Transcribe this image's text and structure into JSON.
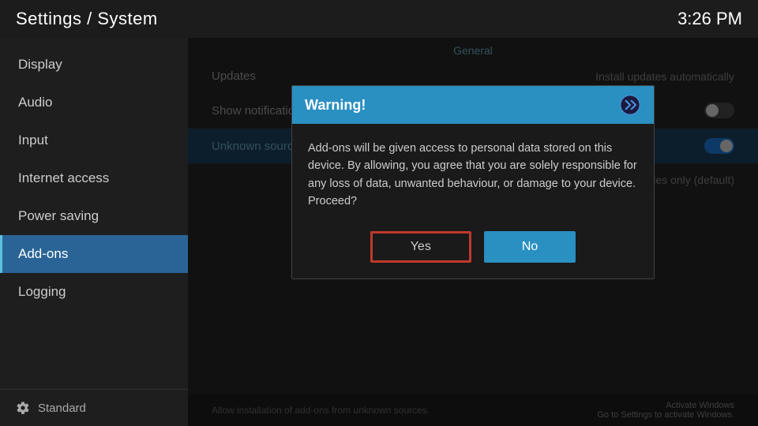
{
  "header": {
    "title": "Settings / System",
    "time": "3:26 PM"
  },
  "sidebar": {
    "items": [
      {
        "id": "display",
        "label": "Display",
        "active": false
      },
      {
        "id": "audio",
        "label": "Audio",
        "active": false
      },
      {
        "id": "input",
        "label": "Input",
        "active": false
      },
      {
        "id": "internet-access",
        "label": "Internet access",
        "active": false
      },
      {
        "id": "power-saving",
        "label": "Power saving",
        "active": false
      },
      {
        "id": "add-ons",
        "label": "Add-ons",
        "active": true
      },
      {
        "id": "logging",
        "label": "Logging",
        "active": false
      }
    ],
    "footer_label": "Standard"
  },
  "content": {
    "section_label": "General",
    "rows": [
      {
        "id": "updates",
        "label": "Updates",
        "value": "Install updates automatically",
        "toggle": null
      },
      {
        "id": "show-notifications",
        "label": "Show notifications",
        "value": "",
        "toggle": "off"
      },
      {
        "id": "unknown-sources",
        "label": "Unknown sources",
        "value": "",
        "toggle": "on",
        "highlighted": true
      },
      {
        "id": "official-repos",
        "label": "",
        "value": "Official repositories only (default)",
        "toggle": null
      }
    ],
    "footer_hint": "Allow installation of add-ons from unknown sources.",
    "activate_windows_line1": "Activate Windows",
    "activate_windows_line2": "Go to Settings to activate Windows."
  },
  "modal": {
    "title": "Warning!",
    "body": "Add-ons will be given access to personal data stored on this device. By allowing, you agree that you are solely responsible for any loss of data, unwanted behaviour, or damage to your device. Proceed?",
    "yes_label": "Yes",
    "no_label": "No"
  }
}
